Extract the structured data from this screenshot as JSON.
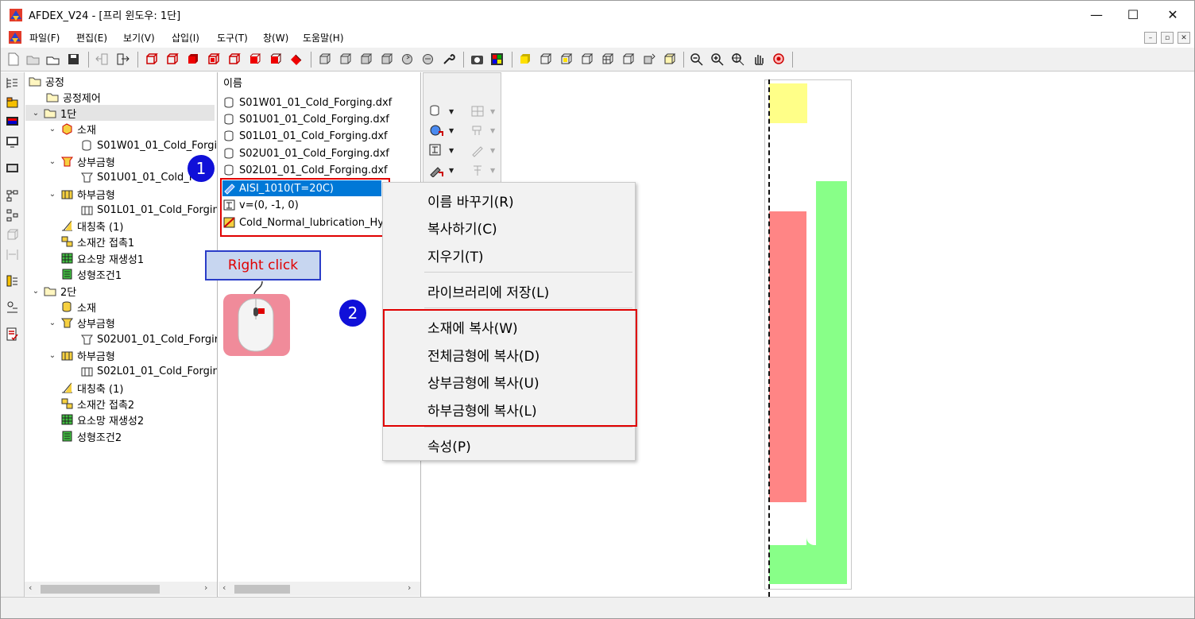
{
  "window": {
    "title": "AFDEX_V24 - [프리 윈도우: 1단]",
    "minimize_glyph": "—",
    "maximize_glyph": "☐",
    "close_glyph": "✕"
  },
  "menu": [
    {
      "label": "파일(F)"
    },
    {
      "label": "편집(E)"
    },
    {
      "label": "보기(V)"
    },
    {
      "label": "삽입(I)"
    },
    {
      "label": "도구(T)"
    },
    {
      "label": "창(W)"
    },
    {
      "label": "도움말(H)"
    }
  ],
  "mdi_controls": [
    "–",
    "▫",
    "✕"
  ],
  "tree": {
    "root": "공정",
    "items": [
      {
        "label": "공정제어"
      },
      {
        "label": "1단"
      },
      {
        "label": "소재"
      },
      {
        "label": "S01W01_01_Cold_Forgi"
      },
      {
        "label": "상부금형"
      },
      {
        "label": "S01U01_01_Cold_F"
      },
      {
        "label": "하부금형"
      },
      {
        "label": "S01L01_01_Cold_Forgin"
      },
      {
        "label": "대칭축 (1)"
      },
      {
        "label": "소재간 접촉1"
      },
      {
        "label": "요소망 재생성1"
      },
      {
        "label": "성형조건1"
      },
      {
        "label": "2단"
      },
      {
        "label": "소재"
      },
      {
        "label": "상부금형"
      },
      {
        "label": "S02U01_01_Cold_Forgir"
      },
      {
        "label": "하부금형"
      },
      {
        "label": "S02L01_01_Cold_Forgin"
      },
      {
        "label": "대칭축 (1)"
      },
      {
        "label": "소재간 접촉2"
      },
      {
        "label": "요소망 재생성2"
      },
      {
        "label": "성형조건2"
      }
    ]
  },
  "list": {
    "header": "이름",
    "items": [
      {
        "label": "S01W01_01_Cold_Forging.dxf"
      },
      {
        "label": "S01U01_01_Cold_Forging.dxf"
      },
      {
        "label": "S01L01_01_Cold_Forging.dxf"
      },
      {
        "label": "S02U01_01_Cold_Forging.dxf"
      },
      {
        "label": "S02L01_01_Cold_Forging.dxf"
      },
      {
        "label": "AISI_1010(T=20C)"
      },
      {
        "label": "v=(0, -1, 0)"
      },
      {
        "label": "Cold_Normal_lubrication_Hybi"
      }
    ]
  },
  "context_menu": {
    "rename": "이름 바꾸기(R)",
    "copy": "복사하기(C)",
    "delete": "지우기(T)",
    "save_library": "라이브러리에 저장(L)",
    "copy_to_material": "소재에 복사(W)",
    "copy_to_all_dies": "전체금형에 복사(D)",
    "copy_to_upper_die": "상부금형에 복사(U)",
    "copy_to_lower_die": "하부금형에 복사(L)",
    "properties": "속성(P)"
  },
  "annotations": {
    "step1": "1",
    "step2": "2",
    "right_click": "Right click"
  },
  "colors": {
    "selection": "#0078d7",
    "annotation_red": "#e00000",
    "badge_blue": "#1010d8",
    "die_yellow": "#ffff88",
    "die_red": "#ff8585",
    "die_green": "#88ff88"
  },
  "chevrons": {
    "open": "⌄",
    "left": "‹",
    "right": "›"
  }
}
